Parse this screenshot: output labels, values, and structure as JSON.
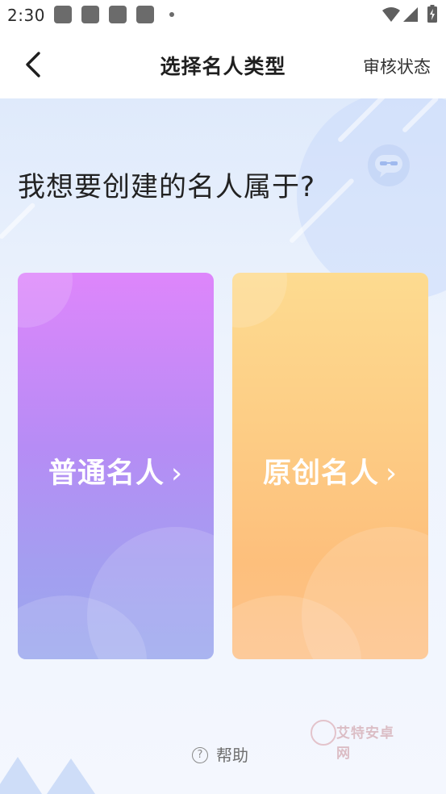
{
  "status_bar": {
    "time": "2:30"
  },
  "header": {
    "title": "选择名人类型",
    "review_status": "审核状态"
  },
  "main": {
    "question": "我想要创建的名人属于?",
    "cards": [
      {
        "label": "普通名人",
        "chevron": "›"
      },
      {
        "label": "原创名人",
        "chevron": "›"
      }
    ],
    "help": {
      "icon": "?",
      "label": "帮助"
    }
  },
  "watermark": {
    "text": "艾特安卓网"
  },
  "icons": {
    "back": "back-arrow-icon",
    "help": "question-circle-icon",
    "wifi": "wifi-icon",
    "signal": "signal-icon",
    "battery": "battery-icon"
  },
  "colors": {
    "card_common_top": "#de86fb",
    "card_common_bottom": "#9ba8ee",
    "card_original_top": "#fddb90",
    "card_original_bottom": "#fdc28a",
    "background": "#edf3fd"
  }
}
